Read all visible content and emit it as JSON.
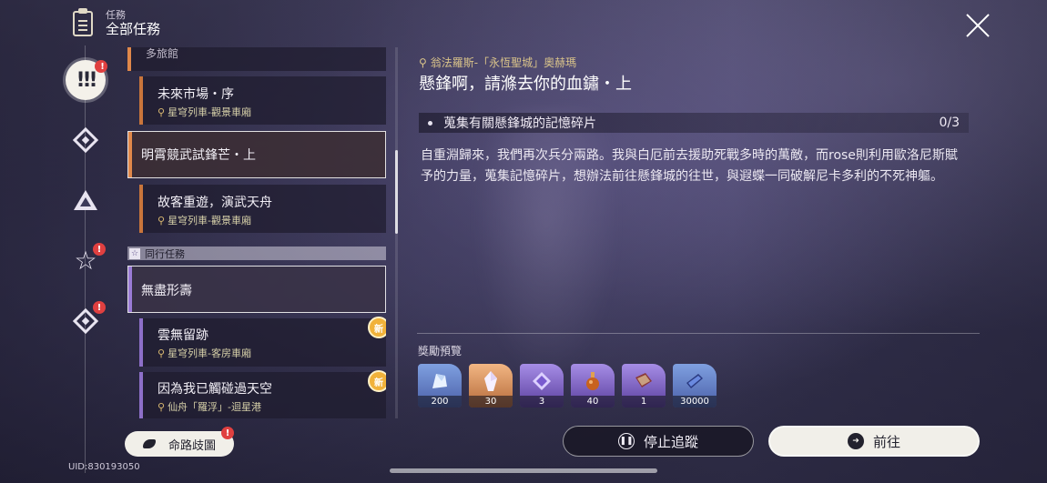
{
  "header": {
    "subtitle": "任務",
    "title": "全部任務"
  },
  "rail": {
    "active_icon": "!!!",
    "badge": "!"
  },
  "quests": [
    {
      "title": "多旅館",
      "style": "partial",
      "accent": "#e0884a"
    },
    {
      "title": "未來市場・序",
      "location": "星穹列車-觀景車廂",
      "accent": "#c9753b",
      "sub": true
    },
    {
      "title": "明霄競武試鋒芒・上",
      "accent": "#e0884a",
      "selected": true
    },
    {
      "title": "故客重遊，演武天舟",
      "location": "星穹列車-觀景車廂",
      "accent": "#c9753b",
      "sub": true
    }
  ],
  "companion_section": {
    "icon": "☆",
    "label": "同行任務"
  },
  "companion_quests": [
    {
      "title": "無盡形壽",
      "accent": "#9a7bd6",
      "highlight": true
    },
    {
      "title": "雲無留跡",
      "location": "星穹列車-客房車廂",
      "accent": "#8d6fc8",
      "sub": true,
      "new_badge": "新"
    },
    {
      "title": "因為我已觸碰過天空",
      "location": "仙舟「羅浮」-迴星港",
      "accent": "#8d6fc8",
      "sub": true,
      "new_badge": "新"
    }
  ],
  "branch_button": "命路歧圖",
  "uid": "UID:830193050",
  "detail": {
    "location": "翁法羅斯-「永恆聖城」奧赫瑪",
    "title": "懸鋒啊，請滌去你的血鏽・上",
    "objective": {
      "text": "蒐集有關懸鋒城的記憶碎片",
      "progress": "0/3"
    },
    "description": "自重淵歸來，我們再次兵分兩路。我與白厄前去援助死戰多時的萬敵，而rose則利用歐洛尼斯賦予的力量，蒐集記憶碎片，想辦法前往懸鋒城的往世，與遐蝶一同破解尼卡多利的不死神軀。",
    "reward_label": "獎勵預覽",
    "rewards": [
      {
        "icon": "ice-crystal-icon",
        "count": "200",
        "color": "#5b7fc4"
      },
      {
        "icon": "crystal-icon",
        "count": "30",
        "color": "#d9935a"
      },
      {
        "icon": "refined-aether-icon",
        "count": "3",
        "color": "#7d5fc4"
      },
      {
        "icon": "potion-flask-icon",
        "count": "40",
        "color": "#7d5fc4"
      },
      {
        "icon": "book-icon",
        "count": "1",
        "color": "#7d5fc4"
      },
      {
        "icon": "credit-card-icon",
        "count": "30000",
        "color": "#5b7fc4"
      }
    ]
  },
  "buttons": {
    "stop_tracking": "停止追蹤",
    "go": "前往"
  }
}
